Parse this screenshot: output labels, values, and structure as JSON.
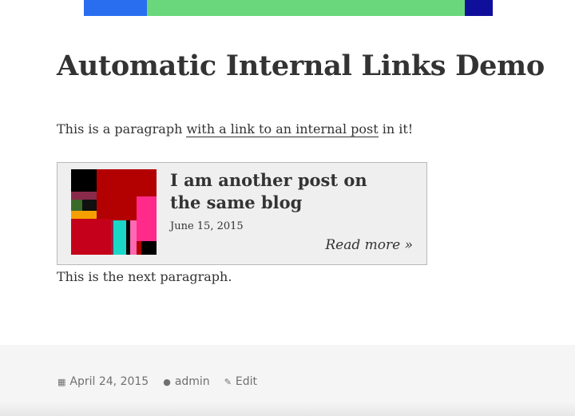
{
  "banner": {
    "colors": [
      "#2a6ef0",
      "#6ad77c",
      "#0f0f9c"
    ]
  },
  "post": {
    "title": "Automatic Internal Links Demo",
    "para1_before": "This is a paragraph ",
    "para1_link": "with a link to an internal post",
    "para1_after": " in it!",
    "para2": "This is the next paragraph."
  },
  "card": {
    "title": "I am another post on the same blog",
    "date": "June 15, 2015",
    "read_more": "Read more »",
    "thumb_colors": [
      "#b30000",
      "#000000",
      "#ff2a8a",
      "#1ad7c8",
      "#8a2a4a",
      "#3a6a2a",
      "#f5a000",
      "#c4001a"
    ]
  },
  "footer": {
    "date": "April 24, 2015",
    "author": "admin",
    "edit_label": "Edit",
    "date_icon": "calendar-icon",
    "author_icon": "person-icon",
    "edit_icon": "pencil-icon"
  }
}
